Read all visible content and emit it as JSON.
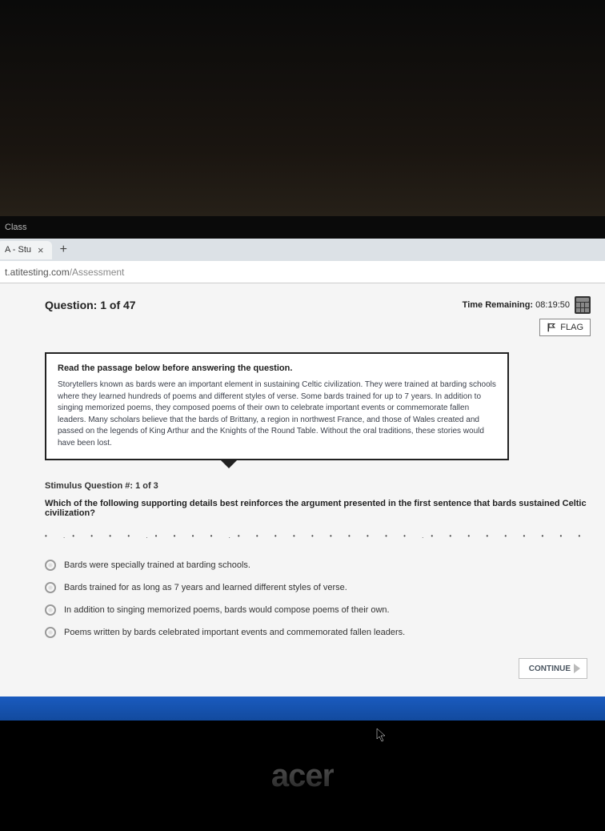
{
  "taskbar": {
    "label": "Class"
  },
  "tab": {
    "title": "A - Stu"
  },
  "url": {
    "host": "t.atitesting.com",
    "path": "/Assessment"
  },
  "header": {
    "question_label": "Question: 1 of 47",
    "time_prefix": "Time Remaining:",
    "time_value": "08:19:50",
    "flag_label": "FLAG"
  },
  "passage": {
    "title": "Read the passage below before answering the question.",
    "body": "Storytellers known as bards were an important element in sustaining Celtic civilization. They were trained at barding schools where they learned hundreds of poems and different styles of verse. Some bards trained for up to 7 years. In addition to singing memorized poems, they composed poems of their own to celebrate important events or commemorate fallen leaders. Many scholars believe that the bards of Brittany, a region in northwest France, and those of Wales created and passed on the legends of King Arthur and the Knights of the Round Table. Without the oral traditions, these stories would have been lost."
  },
  "stimulus_label": "Stimulus Question #:  1  of  3",
  "question": "Which of the following supporting details best reinforces the argument presented in the first sentence that bards sustained Celtic civilization?",
  "options": [
    "Bards were specially trained at barding schools.",
    "Bards trained for as long as 7 years and learned different styles of verse.",
    "In addition to singing memorized poems, bards would compose poems of their own.",
    "Poems written by bards celebrated important events and commemorated fallen leaders."
  ],
  "continue_label": "CONTINUE",
  "logo": "acer"
}
